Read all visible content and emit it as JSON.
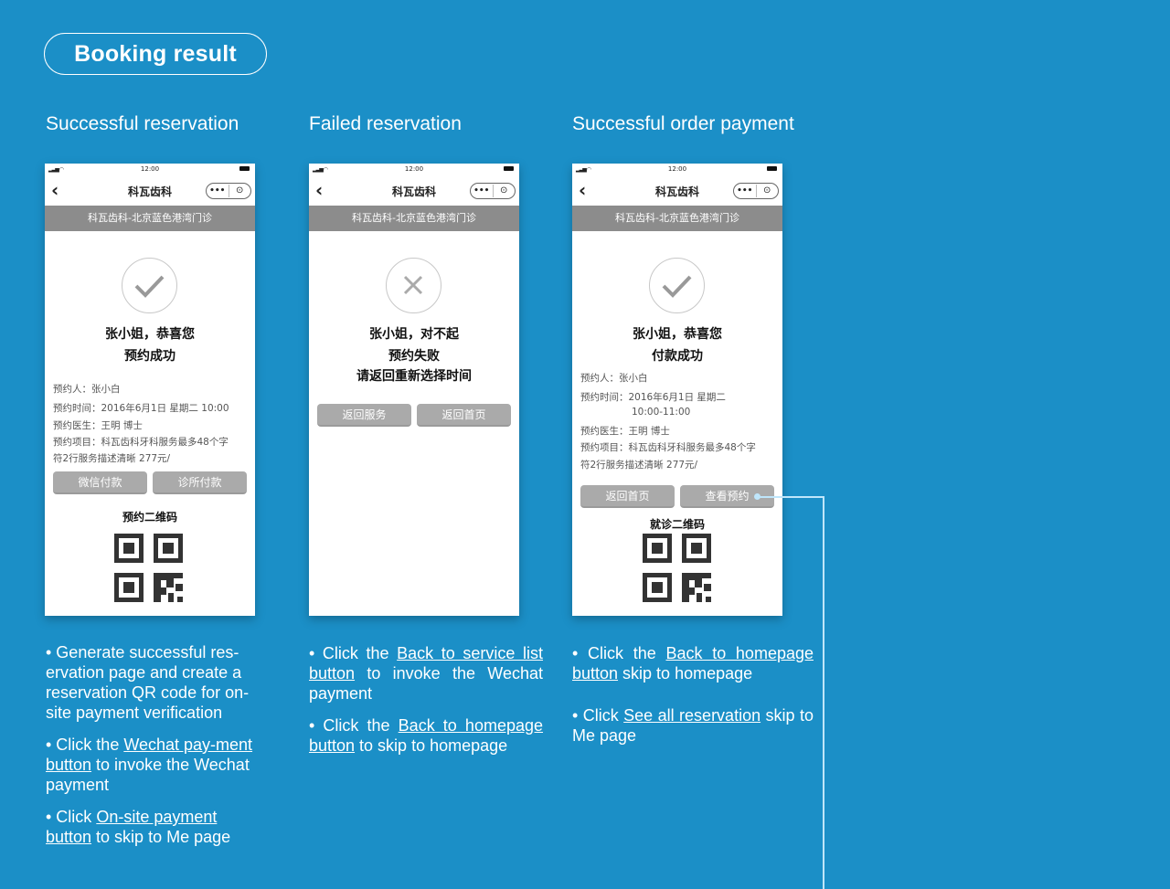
{
  "header": {
    "title": "Booking result"
  },
  "columns": [
    {
      "title": "Successful reservation"
    },
    {
      "title": "Failed reservation"
    },
    {
      "title": "Successful order payment"
    }
  ],
  "phone_common": {
    "status_time": "12:00",
    "nav_title": "科瓦齿科",
    "clinic_banner": "科瓦齿科-北京蓝色港湾门诊",
    "capsule_more": "•••",
    "capsule_close": "⊙"
  },
  "phone1": {
    "greeting": "张小姐，恭喜您",
    "result": "预约成功",
    "details": [
      "预约人：张小白",
      "预约时间：2016年6月1日 星期二 10:00",
      "预约医生：王明 博士",
      "预约项目：科瓦齿科牙科服务最多48个字",
      "符2行服务描述清晰 277元/"
    ],
    "btn_wechat": "微信付款",
    "btn_clinic": "诊所付款",
    "qr_title": "预约二维码"
  },
  "phone2": {
    "greeting": "张小姐，对不起",
    "result": "预约失败",
    "result2": "请返回重新选择时间",
    "btn_service": "返回服务",
    "btn_home": "返回首页"
  },
  "phone3": {
    "greeting": "张小姐，恭喜您",
    "result": "付款成功",
    "details": [
      "预约人：张小白",
      "预约时间：2016年6月1日 星期二",
      "10:00-11:00",
      "预约医生：王明 博士",
      "预约项目：科瓦齿科牙科服务最多48个字",
      "符2行服务描述清晰 277元/"
    ],
    "btn_home": "返回首页",
    "btn_view": "查看预约",
    "qr_title": "就诊二维码"
  },
  "notes": {
    "col1": {
      "n1": "• Generate successful res-ervation page and create a reservation QR code for on-site payment verification",
      "n2_pre": "• Click the ",
      "n2_link": "Wechat pay-ment button",
      "n2_post": " to invoke the Wechat payment",
      "n3_pre": "• Click ",
      "n3_link": "On-site payment button",
      "n3_post": "  to skip to Me page"
    },
    "col2": {
      "n1_pre": "• Click the ",
      "n1_link": "Back to service list button",
      "n1_post": " to invoke the Wechat payment",
      "n2_pre": "• Click the ",
      "n2_link": "Back to homepage button",
      "n2_post": " to skip to homepage"
    },
    "col3": {
      "n1_pre": "• Click the ",
      "n1_link": "Back to homepage button",
      "n1_post": " skip to homepage",
      "n2_pre": "• Click ",
      "n2_link": "See all reservation",
      "n2_post": " skip to Me page"
    }
  }
}
